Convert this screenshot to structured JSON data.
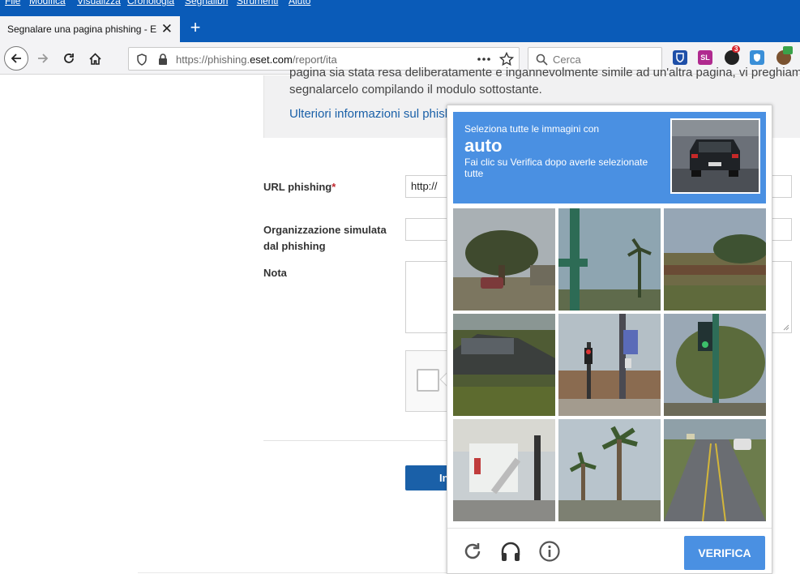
{
  "menu": [
    "File",
    "Modifica",
    "Visualizza",
    "Cronologia",
    "Segnalibri",
    "Strumenti",
    "Aiuto"
  ],
  "tab": {
    "title": "Segnalare una pagina phishing - ESET",
    "close": "✕"
  },
  "newtab": "+",
  "address": {
    "prefix": "https://phishing.",
    "domain": "eset.com",
    "path": "/report/ita"
  },
  "search": {
    "placeholder": "Cerca"
  },
  "extensions": {
    "badge_count": "3",
    "sl_label": "SL"
  },
  "page": {
    "info_line1": "pagina sia stata resa deliberatamente e ingannevolmente simile ad un'altra pagina, vi preghiamo di",
    "info_line2": "segnalarcelo compilando il modulo sottostante.",
    "info_link": "Ulteriori informazioni sul phishing",
    "url_label": "URL phishing",
    "required_mark": "*",
    "url_value": "http://",
    "org_label_1": "Organizzazione simulata",
    "org_label_2": "dal phishing",
    "note_label": "Nota",
    "submit_label": "Invia"
  },
  "captcha": {
    "instruction": "Seleziona tutte le immagini con",
    "object": "auto",
    "sub_instruction": "Fai clic su Verifica dopo averle selezionate tutte",
    "verify_label": "VERIFICA",
    "tiles": [
      "tree-and-car",
      "pole-palms",
      "field-fence",
      "hedge-car",
      "street-traffic-light",
      "traffic-light-tree",
      "porch-stairs",
      "palm-street",
      "road-cars"
    ]
  },
  "colors": {
    "chrome_blue": "#0a5bb8",
    "captcha_blue": "#4a90e2",
    "link_blue": "#1a60a8"
  }
}
